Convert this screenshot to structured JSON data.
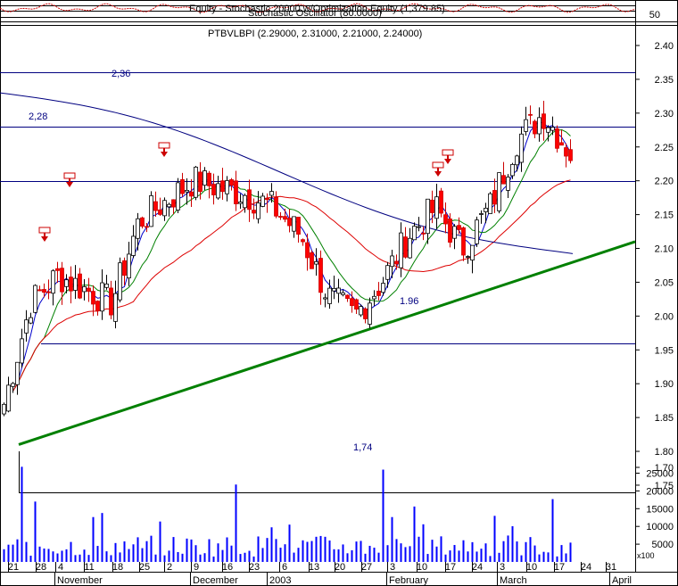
{
  "indicator_pane": {
    "title": "Equity - Stochastic 20000 w/Optimization Equity (1,379.85)",
    "subtitle": "Stochastic Oscillator (80.0000)",
    "tick_label": "50"
  },
  "price_pane": {
    "title": "PTBVLBPI (2.29000, 2.31000, 2.21000, 2.24000)",
    "ticks": [
      "2.40",
      "2.35",
      "2.30",
      "2.25",
      "2.20",
      "2.15",
      "2.10",
      "2.05",
      "2.00",
      "1.95",
      "1.90",
      "1.85",
      "1.80",
      "1.75"
    ],
    "levels": [
      {
        "label": "2,36",
        "value": 2.36
      },
      {
        "label": "2,28",
        "value": 2.28
      },
      {
        "label": "",
        "value": 2.2
      },
      {
        "label": "1.96",
        "value": 1.96
      },
      {
        "label": "1,74",
        "value": 1.74
      }
    ]
  },
  "volume_pane": {
    "ticks": [
      "1.70",
      "25000",
      "20000",
      "15000",
      "10000",
      "5000"
    ],
    "scale_label": "x100"
  },
  "x_axis": {
    "day_labels": [
      "21",
      "28",
      "4",
      "11",
      "18",
      "25",
      "2",
      "9",
      "16",
      "23",
      "6",
      "13",
      "20",
      "27",
      "3",
      "10",
      "17",
      "24",
      "3",
      "10",
      "17",
      "24",
      "31"
    ],
    "month_labels": [
      "November",
      "December",
      "2003",
      "February",
      "March",
      "April"
    ]
  },
  "colors": {
    "up_candle": "#ffffff",
    "down_candle": "#ff0000",
    "ma_fast": "#0000cc",
    "ma_mid": "#008000",
    "ma_slow": "#dd0000",
    "ma_long": "#000080",
    "trendline": "#008000",
    "levels": "#000080",
    "volume": "#0000ff",
    "signal": "#cc0000"
  },
  "chart_data": {
    "type": "candlestick",
    "title": "PTBVLBPI (2.29000, 2.31000, 2.21000, 2.24000)",
    "x": [
      "2002-10-21",
      "2002-10-28",
      "2002-11-04",
      "2002-11-11",
      "2002-11-18",
      "2002-11-25",
      "2002-12-02",
      "2002-12-09",
      "2002-12-16",
      "2002-12-23",
      "2003-01-06",
      "2003-01-13",
      "2003-01-20",
      "2003-01-27",
      "2003-02-03",
      "2003-02-10",
      "2003-02-17",
      "2003-02-24",
      "2003-03-03",
      "2003-03-10",
      "2003-03-17",
      "2003-03-24"
    ],
    "close": [
      1.87,
      2.02,
      2.06,
      2.04,
      2.02,
      2.14,
      2.17,
      2.2,
      2.19,
      2.18,
      2.16,
      2.12,
      2.03,
      2.0,
      2.05,
      2.12,
      2.16,
      2.1,
      2.16,
      2.26,
      2.3,
      2.24
    ],
    "ylim": [
      1.7,
      2.42
    ],
    "horizontal_levels": [
      2.36,
      2.28,
      2.2,
      1.96,
      1.74
    ],
    "trendline": {
      "start": [
        "2002-10-21",
        1.81
      ],
      "end": [
        "2003-04-03",
        2.11
      ]
    },
    "volume_ylim": [
      0,
      27000
    ]
  }
}
